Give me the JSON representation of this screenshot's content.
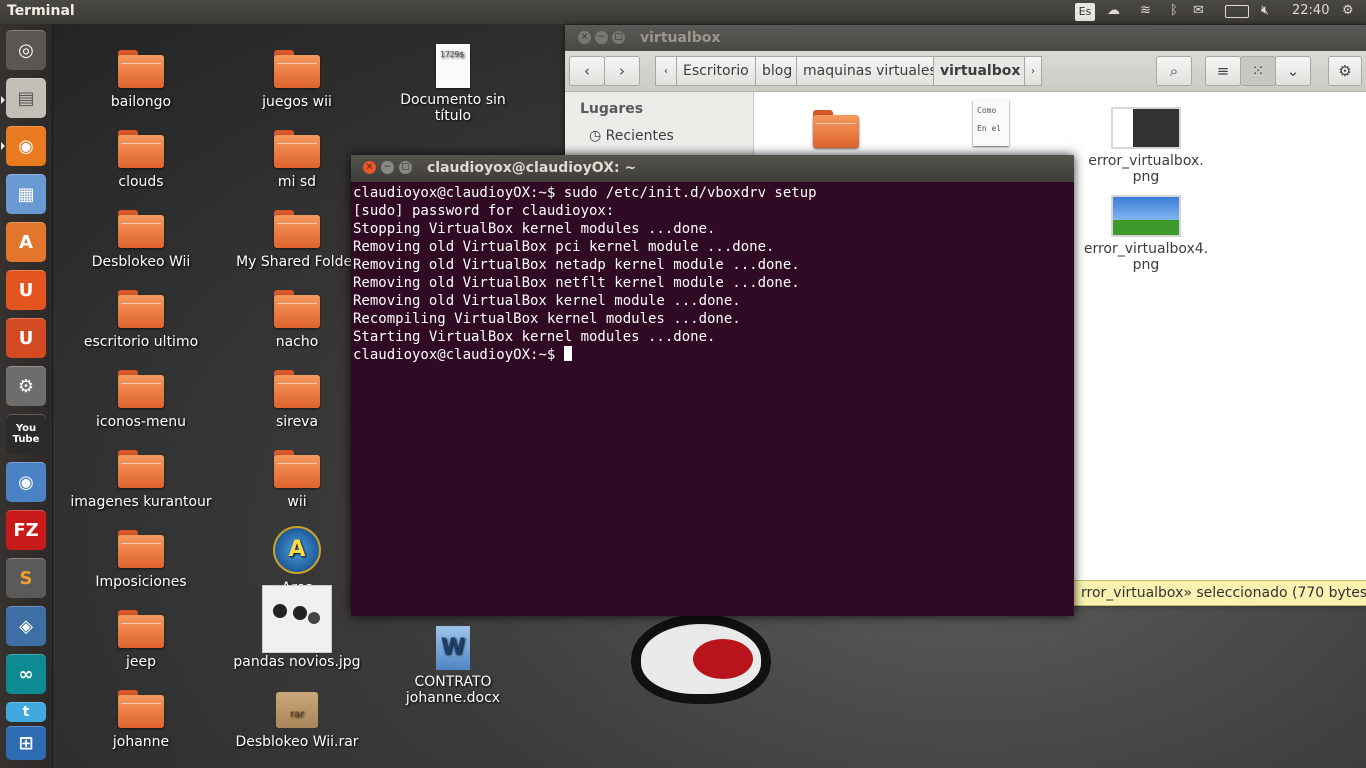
{
  "top_panel": {
    "app_name": "Terminal",
    "keyboard_layout": "Es",
    "clock": "22:40"
  },
  "launcher": {
    "items": [
      {
        "name": "dash",
        "glyph": "◎"
      },
      {
        "name": "files",
        "glyph": "▤"
      },
      {
        "name": "firefox",
        "glyph": "◉"
      },
      {
        "name": "writer",
        "glyph": "▦"
      },
      {
        "name": "software-center",
        "glyph": "A"
      },
      {
        "name": "ubuntu-one",
        "glyph": "U"
      },
      {
        "name": "ubuntu-one-music",
        "glyph": "U"
      },
      {
        "name": "settings",
        "glyph": "⚙"
      },
      {
        "name": "youtube",
        "glyph": "You Tube"
      },
      {
        "name": "chromium",
        "glyph": "◉"
      },
      {
        "name": "filezilla",
        "glyph": "FZ"
      },
      {
        "name": "sublime",
        "glyph": "S"
      },
      {
        "name": "virtualbox",
        "glyph": "◈"
      },
      {
        "name": "arduino",
        "glyph": "∞"
      },
      {
        "name": "twitter",
        "glyph": "t"
      },
      {
        "name": "workspaces",
        "glyph": "⊞"
      }
    ]
  },
  "desktop": {
    "col1": [
      "bailongo",
      "clouds",
      "Desblokeo Wii",
      "escritorio ultimo",
      "iconos-menu",
      "imagenes kurantour",
      "Imposiciones",
      "jeep",
      "johanne"
    ],
    "col2": [
      "juegos wii",
      "mi sd",
      "My Shared Folder",
      "nacho",
      "sireva",
      "wii",
      "Ares",
      "pandas novios.jpg",
      "Desblokeo Wii.rar"
    ],
    "col3": {
      "doc_label_1": "Documento sin",
      "doc_label_2": "título",
      "doc_preview": "1729$",
      "docx_label_1": "CONTRATO",
      "docx_label_2": "johanne.docx",
      "rar_tag": "rar"
    }
  },
  "file_manager": {
    "title": "virtualbox",
    "breadcrumbs": [
      "Escritorio",
      "blog",
      "maquinas virtuales",
      "virtualbox"
    ],
    "sidebar_heading": "Lugares",
    "sidebar_items": [
      "Recientes"
    ],
    "files": [
      {
        "label_1": "error_virtualbox.",
        "label_2": "png"
      },
      {
        "label_1": "error_virtualbox4.",
        "label_2": "png"
      }
    ],
    "text_preview": [
      "Como",
      "En el"
    ],
    "status": "rror_virtualbox» seleccionado  (770 bytes)"
  },
  "terminal": {
    "title": "claudioyox@claudioyOX: ~",
    "lines": [
      "claudioyox@claudioyOX:~$ sudo /etc/init.d/vboxdrv setup",
      "[sudo] password for claudioyox:",
      "Stopping VirtualBox kernel modules ...done.",
      "Removing old VirtualBox pci kernel module ...done.",
      "Removing old VirtualBox netadp kernel module ...done.",
      "Removing old VirtualBox netflt kernel module ...done.",
      "Removing old VirtualBox kernel module ...done.",
      "Recompiling VirtualBox kernel modules ...done.",
      "Starting VirtualBox kernel modules ...done."
    ],
    "prompt": "claudioyox@claudioyOX:~$ "
  }
}
